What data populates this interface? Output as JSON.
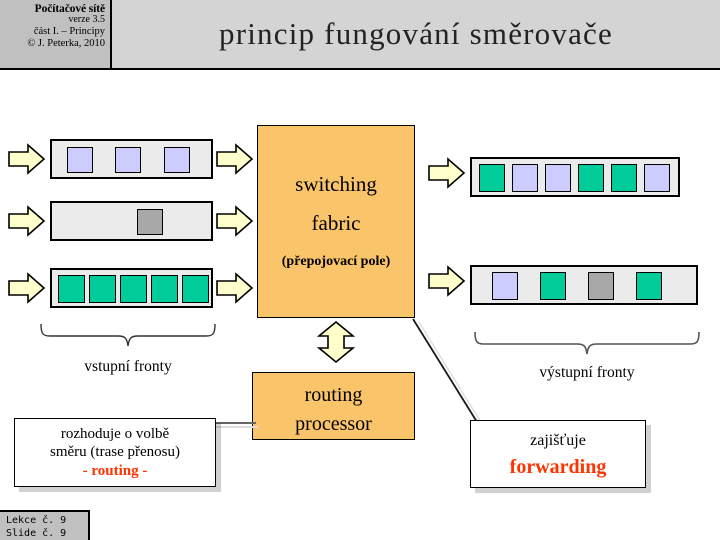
{
  "header": {
    "credit_title": "Počítačové sítě",
    "credit_version": "verze 3.5",
    "credit_part": "část I. – Principy",
    "credit_author": "© J. Peterka, 2010",
    "slide_title": "princip fungování směrovače"
  },
  "fabric": {
    "line1": "switching",
    "line2": "fabric",
    "line3": "(přepojovací pole)"
  },
  "processor": {
    "line1": "routing",
    "line2": "processor"
  },
  "labels": {
    "input_queues": "vstupní fronty",
    "output_queues": "výstupní fronty"
  },
  "callout_routing": {
    "line1": "rozhoduje o volbě",
    "line2": "směru (trase přenosu)",
    "line3_prefix": "- ",
    "line3_term": "routing",
    "line3_suffix": " -"
  },
  "callout_forwarding": {
    "line1": "zajišťuje",
    "line2": "forwarding"
  },
  "colors": {
    "packet_lavender": "#ccccff",
    "packet_green": "#00cc99",
    "packet_gray": "#a8a8a8",
    "fabric_orange": "#f9c46a",
    "arrow_yellow": "#ffffcc",
    "queue_background": "#ebebeb",
    "accent_red": "#ff3300"
  },
  "input_queues": [
    {
      "name": "input-queue-1",
      "packets": [
        "lavender",
        "lavender",
        "lavender"
      ]
    },
    {
      "name": "input-queue-2",
      "packets": [
        "gray"
      ]
    },
    {
      "name": "input-queue-3",
      "packets": [
        "green",
        "green",
        "green",
        "green",
        "green"
      ]
    }
  ],
  "output_queues": [
    {
      "name": "output-queue-1",
      "packets": [
        "green",
        "lavender",
        "lavender",
        "green",
        "green",
        "lavender"
      ]
    },
    {
      "name": "output-queue-2",
      "packets": [
        "lavender",
        "green",
        "gray",
        "green"
      ]
    }
  ],
  "footer": {
    "lecture": "Lekce č. 9",
    "slide": "Slide č. 9"
  }
}
